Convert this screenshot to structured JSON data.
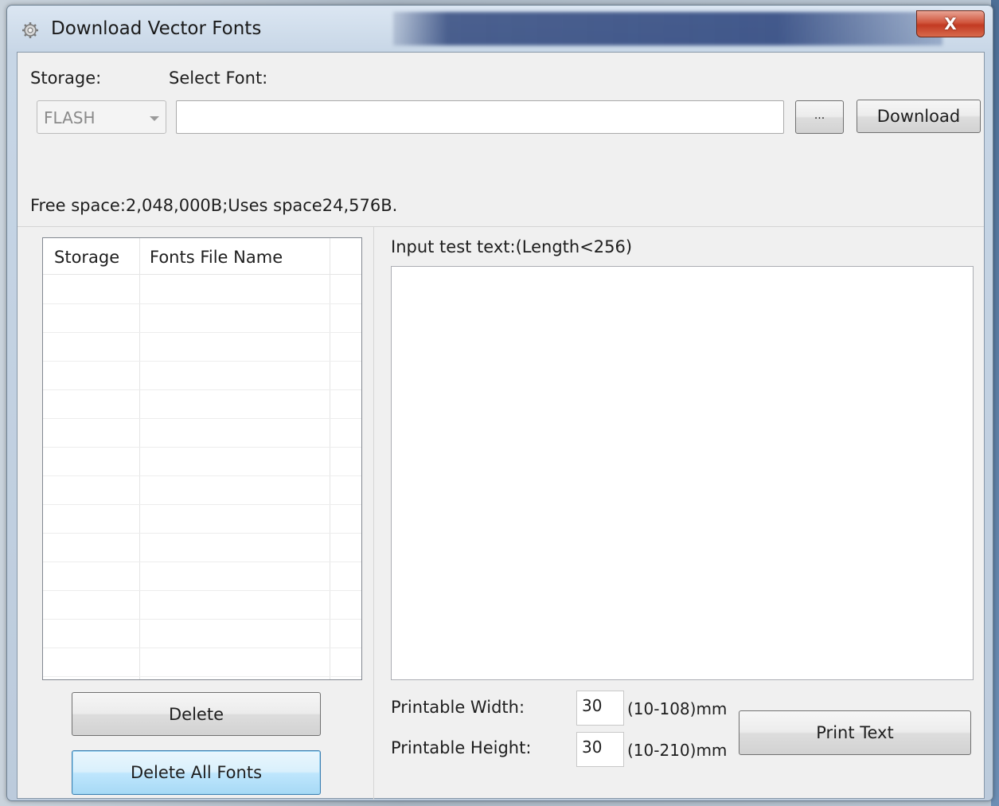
{
  "window": {
    "title": "Download Vector Fonts",
    "close_label": "X"
  },
  "top": {
    "storage_label": "Storage:",
    "storage_value": "FLASH",
    "select_font_label": "Select Font:",
    "select_font_value": "",
    "browse_label": "...",
    "download_label": "Download",
    "space_info": "Free space:2,048,000B;Uses space24,576B."
  },
  "font_list": {
    "columns": [
      "Storage",
      "Fonts File Name"
    ],
    "rows": []
  },
  "left_buttons": {
    "delete_label": "Delete",
    "delete_all_label": "Delete All Fonts"
  },
  "test_panel": {
    "input_label": "Input test text:(Length<256)",
    "input_value": "",
    "width_label": "Printable Width:",
    "width_value": "30",
    "width_range": "(10-108)mm",
    "height_label": "Printable Height:",
    "height_value": "30",
    "height_range": "(10-210)mm",
    "print_label": "Print Text"
  },
  "colors": {
    "close_button": "#c94a2e",
    "focus_button": "#a7d9f5"
  },
  "icons": {
    "title_icon": "gear-icon",
    "combo_arrow": "chevron-down-icon"
  }
}
